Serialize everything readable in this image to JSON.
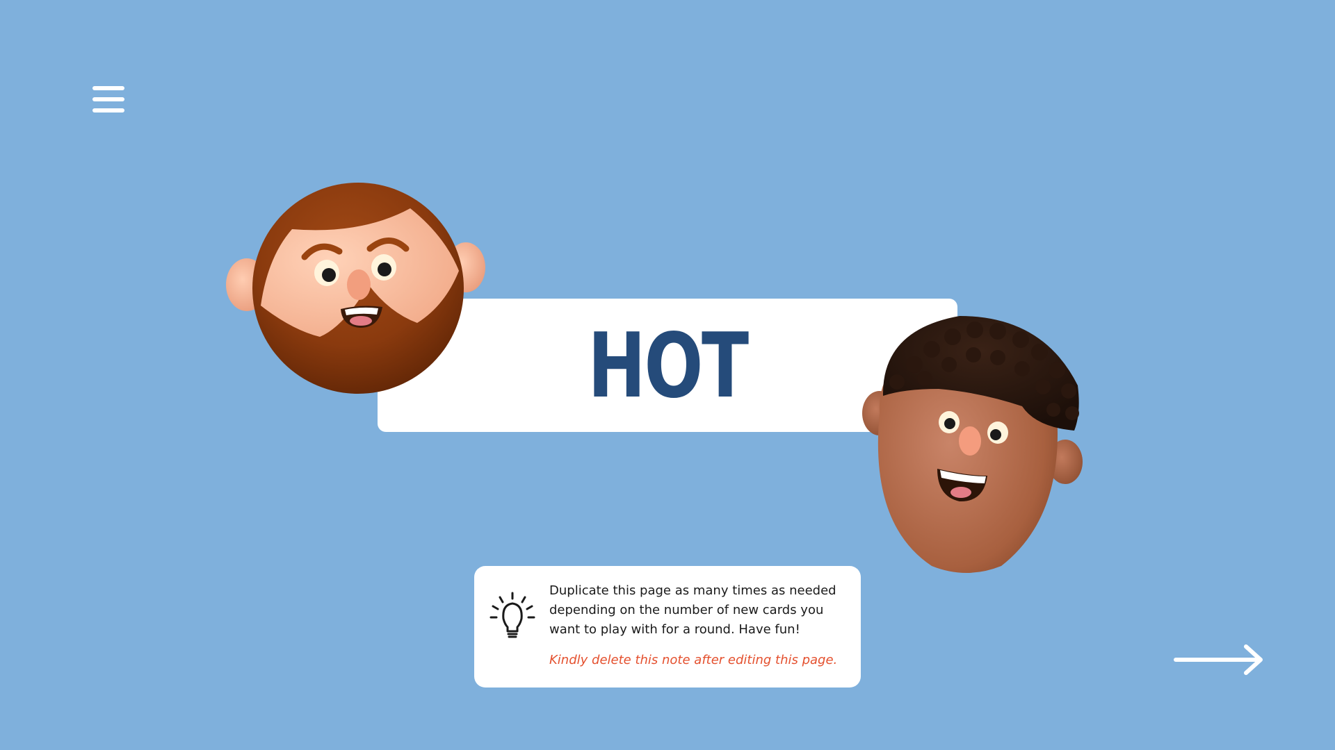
{
  "colors": {
    "background": "#7FB0DC",
    "card": "#FFFFFF",
    "word": "#254B7A",
    "menu_icon": "#FFFFFF",
    "arrow_icon": "#FFFFFF",
    "note_text": "#1A1A1A",
    "note_warning": "#E4502E"
  },
  "menu": {
    "icon": "hamburger-menu-icon"
  },
  "card": {
    "word": "HOT"
  },
  "avatars": [
    {
      "name": "bearded-man-avatar"
    },
    {
      "name": "curly-hair-man-avatar"
    }
  ],
  "note": {
    "icon": "lightbulb-icon",
    "lines": [
      "Duplicate this page as many times as needed",
      "depending on the number of new cards you",
      "want to play with for a round. Have fun!"
    ],
    "warning": "Kindly delete this note after editing this page."
  },
  "navigation": {
    "next_icon": "right-arrow-icon"
  }
}
